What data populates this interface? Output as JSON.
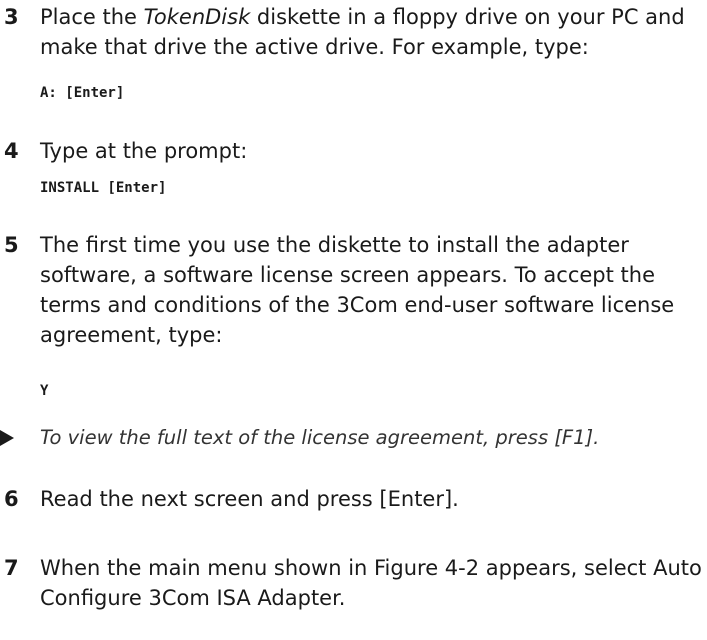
{
  "steps": [
    {
      "number": "3",
      "text_before": "Place the ",
      "text_em": "TokenDisk",
      "text_after": " diskette in a floppy drive on your PC and make that drive the active drive. For example, type:",
      "code": "A: [Enter]"
    },
    {
      "number": "4",
      "text": "Type at the prompt:",
      "code": "INSTALL [Enter]"
    },
    {
      "number": "5",
      "text": "The first time you use the diskette to install the adapter software, a software license screen appears. To accept the terms and conditions of the 3Com end-user software license agreement, type:",
      "code": "Y"
    },
    {
      "number": "6",
      "text": "Read the next screen and press [Enter]."
    },
    {
      "number": "7",
      "text": "When the main menu shown in Figure 4-2 appears, select Auto Configure 3Com ISA Adapter."
    }
  ],
  "note": {
    "icon": "arrow-right-icon",
    "text": "To view the full text of the license agreement, press [F1]."
  }
}
